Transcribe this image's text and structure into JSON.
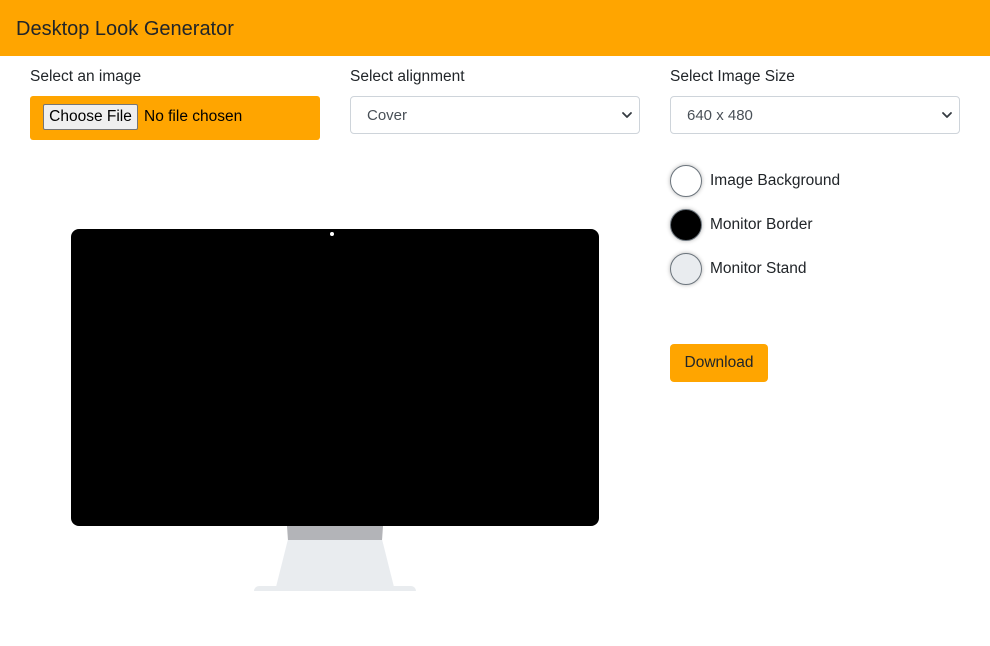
{
  "app": {
    "title": "Desktop Look Generator"
  },
  "controls": {
    "image": {
      "label": "Select an image",
      "button_label": "Choose File",
      "status": "No file chosen"
    },
    "alignment": {
      "label": "Select alignment",
      "selected": "Cover"
    },
    "size": {
      "label": "Select Image Size",
      "selected": "640 x 480"
    }
  },
  "colors": {
    "items": [
      {
        "label": "Image Background",
        "color": "#ffffff"
      },
      {
        "label": "Monitor Border",
        "color": "#000000"
      },
      {
        "label": "Monitor Stand",
        "color": "#e9ecef"
      }
    ]
  },
  "actions": {
    "download_label": "Download"
  },
  "theme": {
    "accent": "#ffa500"
  },
  "preview": {
    "screen_color": "#000000",
    "stand_color": "#e9ecef",
    "neck_color": "#b3b4b8"
  }
}
